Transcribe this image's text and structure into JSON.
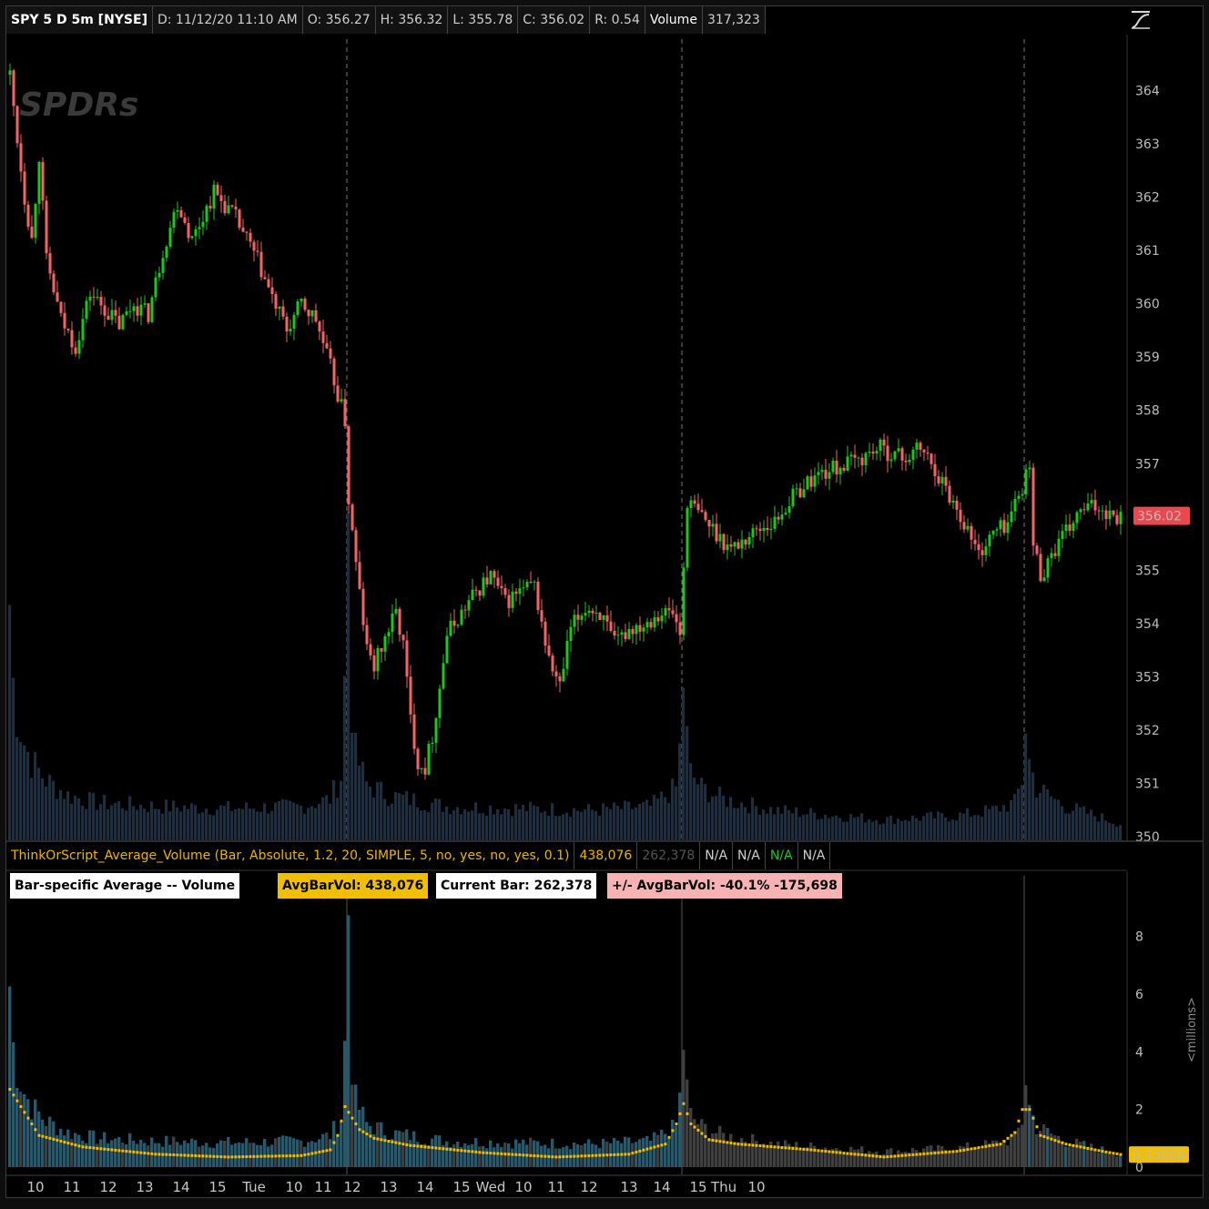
{
  "header": {
    "symbol": "SPY 5 D 5m [NYSE]",
    "date": "D: 11/12/20 11:10 AM",
    "open": "O: 356.27",
    "high": "H: 356.32",
    "low": "L: 355.78",
    "close": "C: 356.02",
    "range": "R: 0.54",
    "volume_label": "Volume",
    "volume_value": "317,323"
  },
  "study": {
    "name": "ThinkOrScript_Average_Volume (Bar, Absolute, 1.2, 20, SIMPLE, 5, no, yes, no, yes, 0.1)",
    "value1": "438,076",
    "value2": "262,378",
    "na1": "N/A",
    "na2": "N/A",
    "na3": "N/A",
    "na4": "N/A"
  },
  "labels": {
    "title": "Bar-specific Average -- Volume",
    "avg": "AvgBarVol: 438,076",
    "current": "Current Bar: 262,378",
    "diff": "+/- AvgBarVol:   -40.1%   -175,698"
  },
  "colors": {
    "up": "#1fc41f",
    "down": "#f06464",
    "avg_line": "#f0c000",
    "volume_bar": "#1a2e44",
    "lower_bar_teal": "#1f5b72",
    "lower_bar_gray": "#3f3f3f",
    "price_badge": "#e8484e"
  },
  "chart_data": [
    {
      "type": "candlestick",
      "title": "SPY 5 D 5m [NYSE]",
      "watermark": "SPDRs",
      "ylim": [
        350,
        365
      ],
      "yticks": [
        350,
        351,
        352,
        353,
        354,
        355,
        356,
        357,
        358,
        359,
        360,
        361,
        362,
        363,
        364
      ],
      "last_price": "356.02",
      "x_labels": [
        "10",
        "11",
        "12",
        "13",
        "14",
        "15",
        "Tue",
        "10",
        "11",
        "12",
        "13",
        "14",
        "15",
        "Wed",
        "10",
        "11",
        "12",
        "13",
        "14",
        "15",
        "Thu",
        "10"
      ],
      "session_breaks": [
        "Tue",
        "Wed",
        "Thu"
      ],
      "path_points": [
        [
          0,
          364.3
        ],
        [
          2,
          363.1
        ],
        [
          4,
          362.0
        ],
        [
          6,
          361.2
        ],
        [
          8,
          362.8
        ],
        [
          10,
          360.8
        ],
        [
          14,
          359.7
        ],
        [
          18,
          359.2
        ],
        [
          22,
          360.2
        ],
        [
          26,
          359.9
        ],
        [
          30,
          359.6
        ],
        [
          34,
          360.0
        ],
        [
          38,
          359.8
        ],
        [
          42,
          361.0
        ],
        [
          46,
          361.9
        ],
        [
          50,
          361.2
        ],
        [
          56,
          362.1
        ],
        [
          62,
          361.6
        ],
        [
          68,
          360.8
        ],
        [
          72,
          360.1
        ],
        [
          76,
          359.5
        ],
        [
          80,
          360.0
        ],
        [
          84,
          359.7
        ],
        [
          88,
          358.8
        ],
        [
          92,
          357.8
        ],
        [
          93,
          356.3
        ],
        [
          95,
          355.1
        ],
        [
          98,
          353.5
        ],
        [
          100,
          353.2
        ],
        [
          104,
          353.9
        ],
        [
          106,
          354.2
        ],
        [
          108,
          353.6
        ],
        [
          110,
          352.2
        ],
        [
          112,
          351.4
        ],
        [
          114,
          351.3
        ],
        [
          116,
          351.9
        ],
        [
          118,
          352.8
        ],
        [
          120,
          353.8
        ],
        [
          124,
          354.2
        ],
        [
          128,
          354.6
        ],
        [
          132,
          354.9
        ],
        [
          136,
          354.4
        ],
        [
          140,
          354.6
        ],
        [
          144,
          354.7
        ],
        [
          148,
          353.3
        ],
        [
          151,
          352.8
        ],
        [
          154,
          353.9
        ],
        [
          158,
          354.3
        ],
        [
          162,
          354.2
        ],
        [
          166,
          353.6
        ],
        [
          170,
          353.9
        ],
        [
          174,
          354.0
        ],
        [
          178,
          354.2
        ],
        [
          182,
          354.2
        ],
        [
          184,
          353.8
        ],
        [
          186,
          356.3
        ],
        [
          190,
          356.0
        ],
        [
          194,
          355.7
        ],
        [
          198,
          355.4
        ],
        [
          202,
          355.6
        ],
        [
          206,
          355.8
        ],
        [
          210,
          355.9
        ],
        [
          214,
          356.3
        ],
        [
          218,
          356.6
        ],
        [
          222,
          356.8
        ],
        [
          226,
          356.9
        ],
        [
          230,
          357.0
        ],
        [
          234,
          357.1
        ],
        [
          238,
          357.3
        ],
        [
          242,
          357.2
        ],
        [
          246,
          357.1
        ],
        [
          250,
          357.3
        ],
        [
          254,
          356.9
        ],
        [
          258,
          356.4
        ],
        [
          262,
          355.9
        ],
        [
          264,
          355.6
        ],
        [
          266,
          355.3
        ],
        [
          270,
          355.7
        ],
        [
          274,
          355.9
        ],
        [
          278,
          356.6
        ],
        [
          280,
          356.9
        ],
        [
          281,
          355.5
        ],
        [
          283,
          354.9
        ],
        [
          286,
          355.3
        ],
        [
          290,
          355.7
        ],
        [
          294,
          356.1
        ],
        [
          298,
          356.2
        ],
        [
          302,
          356.1
        ],
        [
          305,
          356.0
        ]
      ],
      "volume_overlay_scale_millions": 8
    },
    {
      "type": "bar",
      "title": "Bar-specific Average -- Volume",
      "ylabel": "<millions>",
      "ylim": [
        0,
        9
      ],
      "yticks": [
        0,
        2,
        4,
        6,
        8
      ],
      "current_value": "0.43808",
      "avg_bar_vol": 438076,
      "current_bar": 262378,
      "diff_pct": -40.1,
      "diff_abs": -175698,
      "anchors_millions": [
        [
          0,
          6.3
        ],
        [
          1,
          4.2
        ],
        [
          2,
          3.4
        ],
        [
          4,
          2.6
        ],
        [
          6,
          2.1
        ],
        [
          10,
          1.6
        ],
        [
          16,
          1.2
        ],
        [
          24,
          1.0
        ],
        [
          40,
          0.9
        ],
        [
          60,
          0.85
        ],
        [
          80,
          0.9
        ],
        [
          88,
          1.1
        ],
        [
          91,
          1.7
        ],
        [
          92,
          4.2
        ],
        [
          93,
          9.0
        ],
        [
          94,
          3.6
        ],
        [
          95,
          2.3
        ],
        [
          98,
          1.5
        ],
        [
          104,
          1.2
        ],
        [
          120,
          0.9
        ],
        [
          140,
          0.85
        ],
        [
          160,
          0.8
        ],
        [
          176,
          0.9
        ],
        [
          183,
          1.4
        ],
        [
          184,
          2.4
        ],
        [
          185,
          4.3
        ],
        [
          186,
          2.7
        ],
        [
          187,
          1.8
        ],
        [
          190,
          1.4
        ],
        [
          196,
          1.1
        ],
        [
          210,
          0.8
        ],
        [
          240,
          0.55
        ],
        [
          260,
          0.65
        ],
        [
          270,
          0.8
        ],
        [
          276,
          1.0
        ],
        [
          278,
          1.6
        ],
        [
          279,
          3.1
        ],
        [
          280,
          2.1
        ],
        [
          282,
          1.4
        ],
        [
          290,
          0.9
        ],
        [
          300,
          0.6
        ],
        [
          305,
          0.44
        ]
      ],
      "avg_anchors_millions": [
        [
          0,
          2.7
        ],
        [
          4,
          1.9
        ],
        [
          8,
          1.1
        ],
        [
          20,
          0.7
        ],
        [
          40,
          0.45
        ],
        [
          60,
          0.35
        ],
        [
          80,
          0.4
        ],
        [
          88,
          0.6
        ],
        [
          90,
          1.1
        ],
        [
          92,
          2.1
        ],
        [
          96,
          1.3
        ],
        [
          100,
          1.0
        ],
        [
          110,
          0.75
        ],
        [
          130,
          0.5
        ],
        [
          150,
          0.35
        ],
        [
          170,
          0.45
        ],
        [
          180,
          0.8
        ],
        [
          183,
          1.5
        ],
        [
          185,
          2.2
        ],
        [
          187,
          1.5
        ],
        [
          192,
          0.95
        ],
        [
          200,
          0.8
        ],
        [
          220,
          0.6
        ],
        [
          240,
          0.35
        ],
        [
          260,
          0.55
        ],
        [
          272,
          0.8
        ],
        [
          276,
          1.2
        ],
        [
          278,
          2.0
        ],
        [
          280,
          2.0
        ],
        [
          283,
          1.1
        ],
        [
          290,
          0.8
        ],
        [
          300,
          0.55
        ],
        [
          305,
          0.44
        ]
      ]
    }
  ]
}
